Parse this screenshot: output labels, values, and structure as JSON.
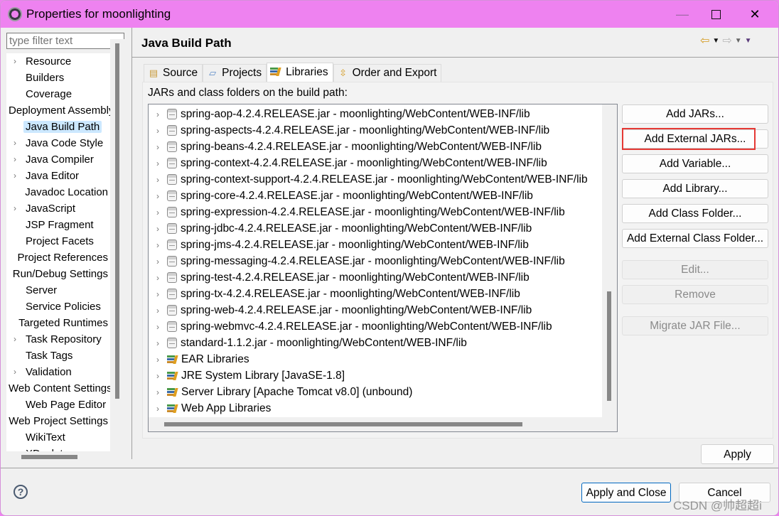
{
  "window": {
    "title": "Properties for moonlighting",
    "minimize_label": "—",
    "close_label": "✕"
  },
  "sidebar": {
    "filter_placeholder": "type filter text",
    "items": [
      {
        "label": "Resource",
        "expandable": true
      },
      {
        "label": "Builders",
        "expandable": false
      },
      {
        "label": "Coverage",
        "expandable": false
      },
      {
        "label": "Deployment Assembly",
        "expandable": false
      },
      {
        "label": "Java Build Path",
        "expandable": false,
        "selected": true
      },
      {
        "label": "Java Code Style",
        "expandable": true
      },
      {
        "label": "Java Compiler",
        "expandable": true
      },
      {
        "label": "Java Editor",
        "expandable": true
      },
      {
        "label": "Javadoc Location",
        "expandable": false
      },
      {
        "label": "JavaScript",
        "expandable": true
      },
      {
        "label": "JSP Fragment",
        "expandable": false
      },
      {
        "label": "Project Facets",
        "expandable": false
      },
      {
        "label": "Project References",
        "expandable": false
      },
      {
        "label": "Run/Debug Settings",
        "expandable": false
      },
      {
        "label": "Server",
        "expandable": false
      },
      {
        "label": "Service Policies",
        "expandable": false
      },
      {
        "label": "Targeted Runtimes",
        "expandable": false
      },
      {
        "label": "Task Repository",
        "expandable": true
      },
      {
        "label": "Task Tags",
        "expandable": false
      },
      {
        "label": "Validation",
        "expandable": true
      },
      {
        "label": "Web Content Settings",
        "expandable": false
      },
      {
        "label": "Web Page Editor",
        "expandable": false
      },
      {
        "label": "Web Project Settings",
        "expandable": false
      },
      {
        "label": "WikiText",
        "expandable": false
      },
      {
        "label": "XDoclet",
        "expandable": true
      }
    ]
  },
  "page": {
    "heading": "Java Build Path",
    "nav": {
      "back": "⇦",
      "forward": "⇨",
      "dropdown": "▼"
    },
    "tabs": [
      {
        "label": "Source",
        "icon": "source-folder-icon"
      },
      {
        "label": "Projects",
        "icon": "folder-icon"
      },
      {
        "label": "Libraries",
        "icon": "library-icon",
        "active": true
      },
      {
        "label": "Order and Export",
        "icon": "order-export-icon"
      }
    ],
    "list_label": "JARs and class folders on the build path:",
    "entries": [
      {
        "type": "jar",
        "text": "spring-aop-4.2.4.RELEASE.jar - moonlighting/WebContent/WEB-INF/lib"
      },
      {
        "type": "jar",
        "text": "spring-aspects-4.2.4.RELEASE.jar - moonlighting/WebContent/WEB-INF/lib"
      },
      {
        "type": "jar",
        "text": "spring-beans-4.2.4.RELEASE.jar - moonlighting/WebContent/WEB-INF/lib"
      },
      {
        "type": "jar",
        "text": "spring-context-4.2.4.RELEASE.jar - moonlighting/WebContent/WEB-INF/lib"
      },
      {
        "type": "jar",
        "text": "spring-context-support-4.2.4.RELEASE.jar - moonlighting/WebContent/WEB-INF/lib"
      },
      {
        "type": "jar",
        "text": "spring-core-4.2.4.RELEASE.jar - moonlighting/WebContent/WEB-INF/lib"
      },
      {
        "type": "jar",
        "text": "spring-expression-4.2.4.RELEASE.jar - moonlighting/WebContent/WEB-INF/lib"
      },
      {
        "type": "jar",
        "text": "spring-jdbc-4.2.4.RELEASE.jar - moonlighting/WebContent/WEB-INF/lib"
      },
      {
        "type": "jar",
        "text": "spring-jms-4.2.4.RELEASE.jar - moonlighting/WebContent/WEB-INF/lib"
      },
      {
        "type": "jar",
        "text": "spring-messaging-4.2.4.RELEASE.jar - moonlighting/WebContent/WEB-INF/lib"
      },
      {
        "type": "jar",
        "text": "spring-test-4.2.4.RELEASE.jar - moonlighting/WebContent/WEB-INF/lib"
      },
      {
        "type": "jar",
        "text": "spring-tx-4.2.4.RELEASE.jar - moonlighting/WebContent/WEB-INF/lib"
      },
      {
        "type": "jar",
        "text": "spring-web-4.2.4.RELEASE.jar - moonlighting/WebContent/WEB-INF/lib"
      },
      {
        "type": "jar",
        "text": "spring-webmvc-4.2.4.RELEASE.jar - moonlighting/WebContent/WEB-INF/lib"
      },
      {
        "type": "jar",
        "text": "standard-1.1.2.jar - moonlighting/WebContent/WEB-INF/lib"
      },
      {
        "type": "library",
        "text": "EAR Libraries"
      },
      {
        "type": "library",
        "text": "JRE System Library [JavaSE-1.8]"
      },
      {
        "type": "library",
        "text": "Server Library [Apache Tomcat v8.0] (unbound)"
      },
      {
        "type": "library",
        "text": "Web App Libraries"
      }
    ],
    "buttons": [
      {
        "label": "Add JARs...",
        "enabled": true
      },
      {
        "label": "Add External JARs...",
        "enabled": true,
        "highlighted": true
      },
      {
        "label": "Add Variable...",
        "enabled": true
      },
      {
        "label": "Add Library...",
        "enabled": true
      },
      {
        "label": "Add Class Folder...",
        "enabled": true
      },
      {
        "label": "Add External Class Folder...",
        "enabled": true
      },
      {
        "label": "Edit...",
        "enabled": false
      },
      {
        "label": "Remove",
        "enabled": false
      },
      {
        "label": "Migrate JAR File...",
        "enabled": false
      }
    ],
    "apply_label": "Apply"
  },
  "footer": {
    "help_label": "?",
    "apply_close_label": "Apply and Close",
    "cancel_label": "Cancel",
    "watermark": "CSDN @帅超超i"
  },
  "colors": {
    "titlebar": "#ee82f0",
    "highlight_box": "#e53935",
    "selection": "#cce8ff",
    "default_button_border": "#0067c0"
  }
}
